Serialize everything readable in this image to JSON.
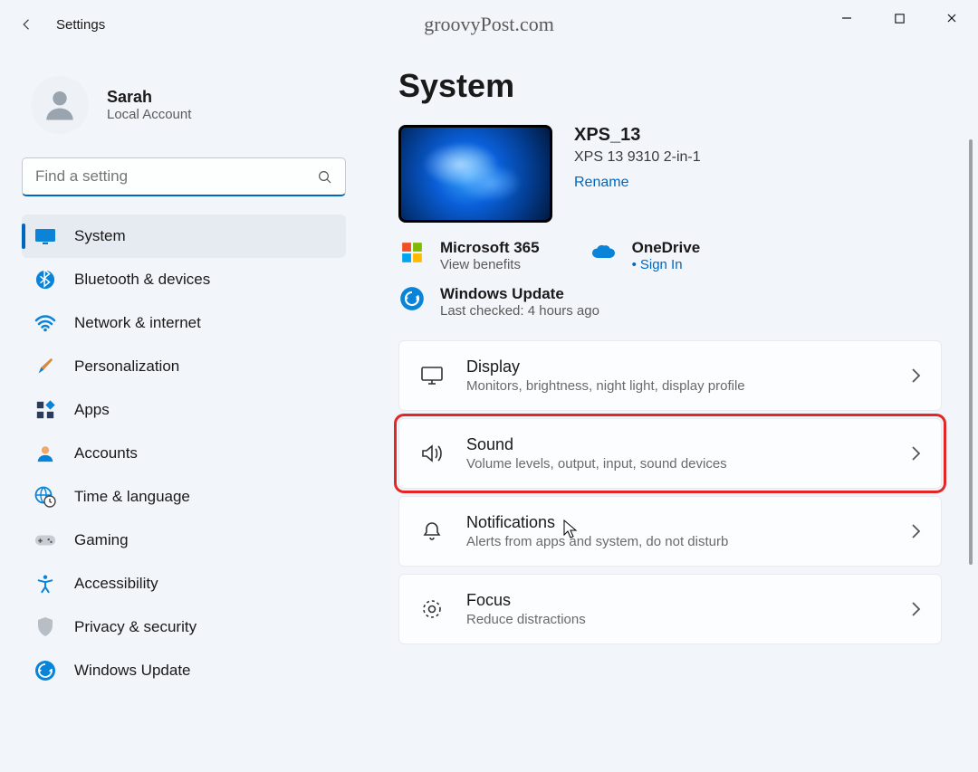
{
  "titlebar": {
    "app_name": "Settings",
    "watermark": "groovyPost.com"
  },
  "user": {
    "name": "Sarah",
    "account_type": "Local Account"
  },
  "search": {
    "placeholder": "Find a setting"
  },
  "nav": {
    "items": [
      {
        "label": "System",
        "icon": "display-icon",
        "active": true
      },
      {
        "label": "Bluetooth & devices",
        "icon": "bluetooth-icon"
      },
      {
        "label": "Network & internet",
        "icon": "wifi-icon"
      },
      {
        "label": "Personalization",
        "icon": "brush-icon"
      },
      {
        "label": "Apps",
        "icon": "apps-icon"
      },
      {
        "label": "Accounts",
        "icon": "person-icon"
      },
      {
        "label": "Time & language",
        "icon": "globe-clock-icon"
      },
      {
        "label": "Gaming",
        "icon": "gamepad-icon"
      },
      {
        "label": "Accessibility",
        "icon": "accessibility-icon"
      },
      {
        "label": "Privacy & security",
        "icon": "shield-icon"
      },
      {
        "label": "Windows Update",
        "icon": "update-icon"
      }
    ]
  },
  "page": {
    "title": "System",
    "device": {
      "name": "XPS_13",
      "model": "XPS 13 9310 2-in-1",
      "rename_label": "Rename"
    },
    "services": {
      "m365": {
        "title": "Microsoft 365",
        "sub": "View benefits"
      },
      "onedrive": {
        "title": "OneDrive",
        "sub": "Sign In"
      },
      "update": {
        "title": "Windows Update",
        "sub": "Last checked: 4 hours ago"
      }
    },
    "cards": [
      {
        "title": "Display",
        "sub": "Monitors, brightness, night light, display profile",
        "icon": "monitor-icon",
        "highlight": false
      },
      {
        "title": "Sound",
        "sub": "Volume levels, output, input, sound devices",
        "icon": "speaker-icon",
        "highlight": true
      },
      {
        "title": "Notifications",
        "sub": "Alerts from apps and system, do not disturb",
        "icon": "bell-icon",
        "highlight": false
      },
      {
        "title": "Focus",
        "sub": "Reduce distractions",
        "icon": "focus-icon",
        "highlight": false
      }
    ]
  }
}
